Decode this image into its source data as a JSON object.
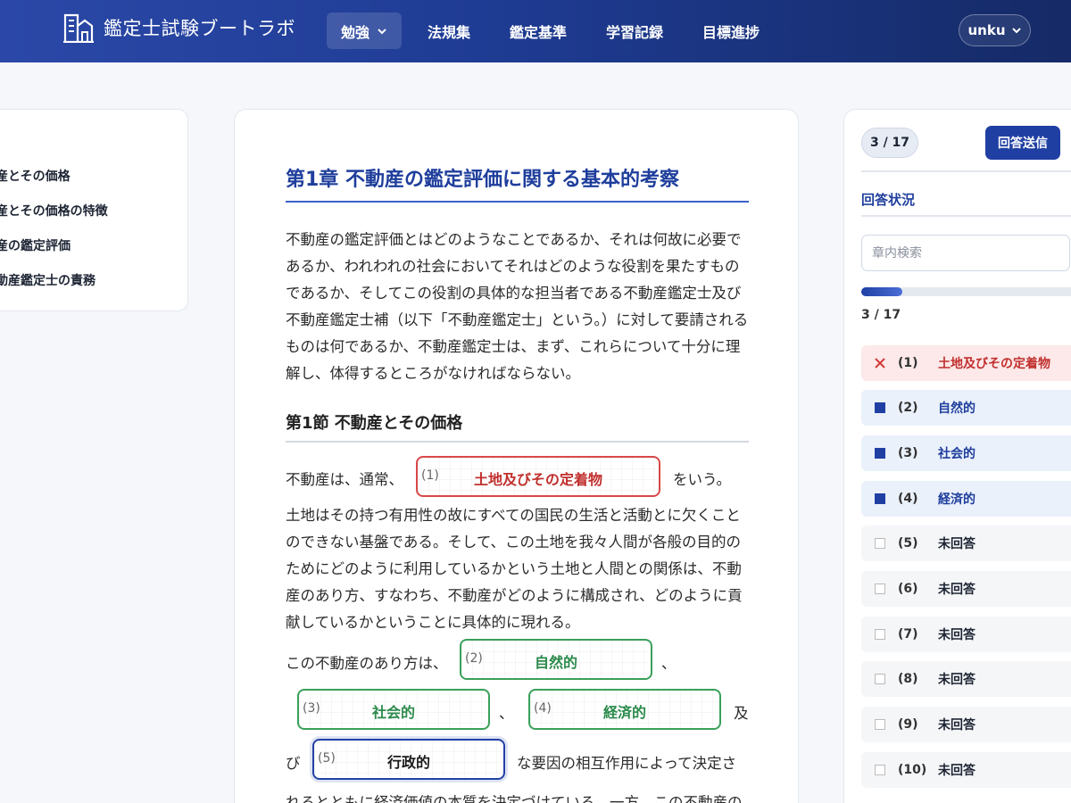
{
  "header": {
    "brand": "鑑定士試験ブートラボ",
    "nav": [
      {
        "label": "勉強",
        "active": true
      },
      {
        "label": "法規集"
      },
      {
        "label": "鑑定基準"
      },
      {
        "label": "学習記録"
      },
      {
        "label": "目標進捗"
      }
    ],
    "user": "unku"
  },
  "toc": {
    "items": [
      "動産とその価格",
      "動産とその価格の特徴",
      "動産の鑑定評価",
      "不動産鑑定士の責務"
    ]
  },
  "content": {
    "chapter_title": "第1章 不動産の鑑定評価に関する基本的考察",
    "intro_lines": [
      "不動産の鑑定評価とはどのようなことであるか、それは何故に必要で",
      "あるか、われわれの社会においてそれはどのような役割を果たすもの",
      "であるか、そしてこの役割の具体的な担当者である不動産鑑定士及び",
      "不動産鑑定士補（以下「不動産鑑定士」という。）に対して要請される",
      "ものは何であるか、不動産鑑定士は、まず、これらについて十分に理",
      "解し、体得するところがなければならない。"
    ],
    "section_title": "第1節 不動産とその価格",
    "s1_before": "不動産は、通常、",
    "s1_after": "をいう。",
    "para2_lines": [
      "土地はその持つ有用性の故にすべての国民の生活と活動とに欠くこと",
      "のできない基盤である。そして、この土地を我々人間が各般の目的の",
      "ためにどのように利用しているかという土地と人間との関係は、不動",
      "産のあり方、すなわち、不動産がどのように構成され、どのように貢",
      "献しているかということに具体的に現れる。"
    ],
    "s2_before": "この不動産のあり方は、",
    "sep_comma": "、",
    "sep_oyo": "及",
    "sep_bi": "び",
    "s5_after": "な要因の相互作用によって決定さ",
    "last_line": "れるとともに経済価値の本質を決定づけている。一方、この不動産の",
    "blanks": [
      {
        "num": "(1)",
        "answer": "土地及びその定着物",
        "state": "wrong"
      },
      {
        "num": "(2)",
        "answer": "自然的",
        "state": "correct"
      },
      {
        "num": "(3)",
        "answer": "社会的",
        "state": "correct"
      },
      {
        "num": "(4)",
        "answer": "経済的",
        "state": "correct"
      },
      {
        "num": "(5)",
        "answer": "行政的",
        "state": "active"
      }
    ]
  },
  "sidebar": {
    "progress": "3 / 17",
    "submit_label": "回答送信",
    "status_title": "回答状況",
    "search_placeholder": "章内検索",
    "progress_fraction": 0.1765,
    "progress_count": "3 / 17",
    "rows": [
      {
        "num": "(1)",
        "text": "土地及びその定着物",
        "state": "wrong"
      },
      {
        "num": "(2)",
        "text": "自然的",
        "state": "done"
      },
      {
        "num": "(3)",
        "text": "社会的",
        "state": "done"
      },
      {
        "num": "(4)",
        "text": "経済的",
        "state": "done"
      },
      {
        "num": "(5)",
        "text": "未回答",
        "state": "pending"
      },
      {
        "num": "(6)",
        "text": "未回答",
        "state": "pending"
      },
      {
        "num": "(7)",
        "text": "未回答",
        "state": "pending"
      },
      {
        "num": "(8)",
        "text": "未回答",
        "state": "pending"
      },
      {
        "num": "(9)",
        "text": "未回答",
        "state": "pending"
      },
      {
        "num": "(10)",
        "text": "未回答",
        "state": "pending"
      }
    ]
  },
  "colors": {
    "header_start": "#2b48a8",
    "header_end": "#152a66",
    "accent": "#1f3fa3",
    "wrong": "#d94848",
    "correct": "#3aa05a"
  }
}
